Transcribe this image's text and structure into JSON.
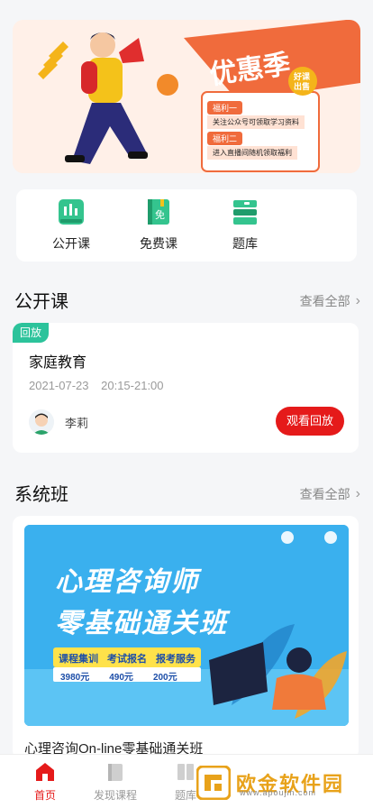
{
  "banner": {
    "title": "优惠季",
    "tag_line1": "好课",
    "tag_line2": "出售",
    "perk1_label": "福利一",
    "perk1_text": "关注公众号可领取学习资料",
    "perk2_label": "福利二",
    "perk2_text": "进入直播间随机领取福利"
  },
  "quick": {
    "items": [
      {
        "label": "公开课",
        "icon": "live-course-icon"
      },
      {
        "label": "免费课",
        "icon": "free-course-icon"
      },
      {
        "label": "题库",
        "icon": "question-bank-icon"
      }
    ]
  },
  "public_section": {
    "title": "公开课",
    "more": "查看全部",
    "course": {
      "badge": "回放",
      "title": "家庭教育",
      "date": "2021-07-23",
      "time": "20:15-21:00",
      "teacher": "李莉",
      "action": "观看回放"
    }
  },
  "system_section": {
    "title": "系统班",
    "more": "查看全部",
    "poster": {
      "headline1": "心理咨询师",
      "headline2": "零基础通关班",
      "tags": [
        "课程集训",
        "考试报名",
        "报考服务"
      ],
      "prices": [
        "3980元",
        "490元",
        "200元"
      ]
    },
    "caption": "心理咨询On-line零基础通关班"
  },
  "tabbar": {
    "tabs": [
      {
        "label": "首页",
        "active": true
      },
      {
        "label": "发现课程",
        "active": false
      },
      {
        "label": "题库",
        "active": false
      }
    ]
  },
  "watermark": {
    "text": "欧金软件园",
    "sub": "www.apoujin.com"
  },
  "colors": {
    "accent": "#e51a1a",
    "green": "#2cc39b",
    "banner_orange": "#f06b3c"
  }
}
